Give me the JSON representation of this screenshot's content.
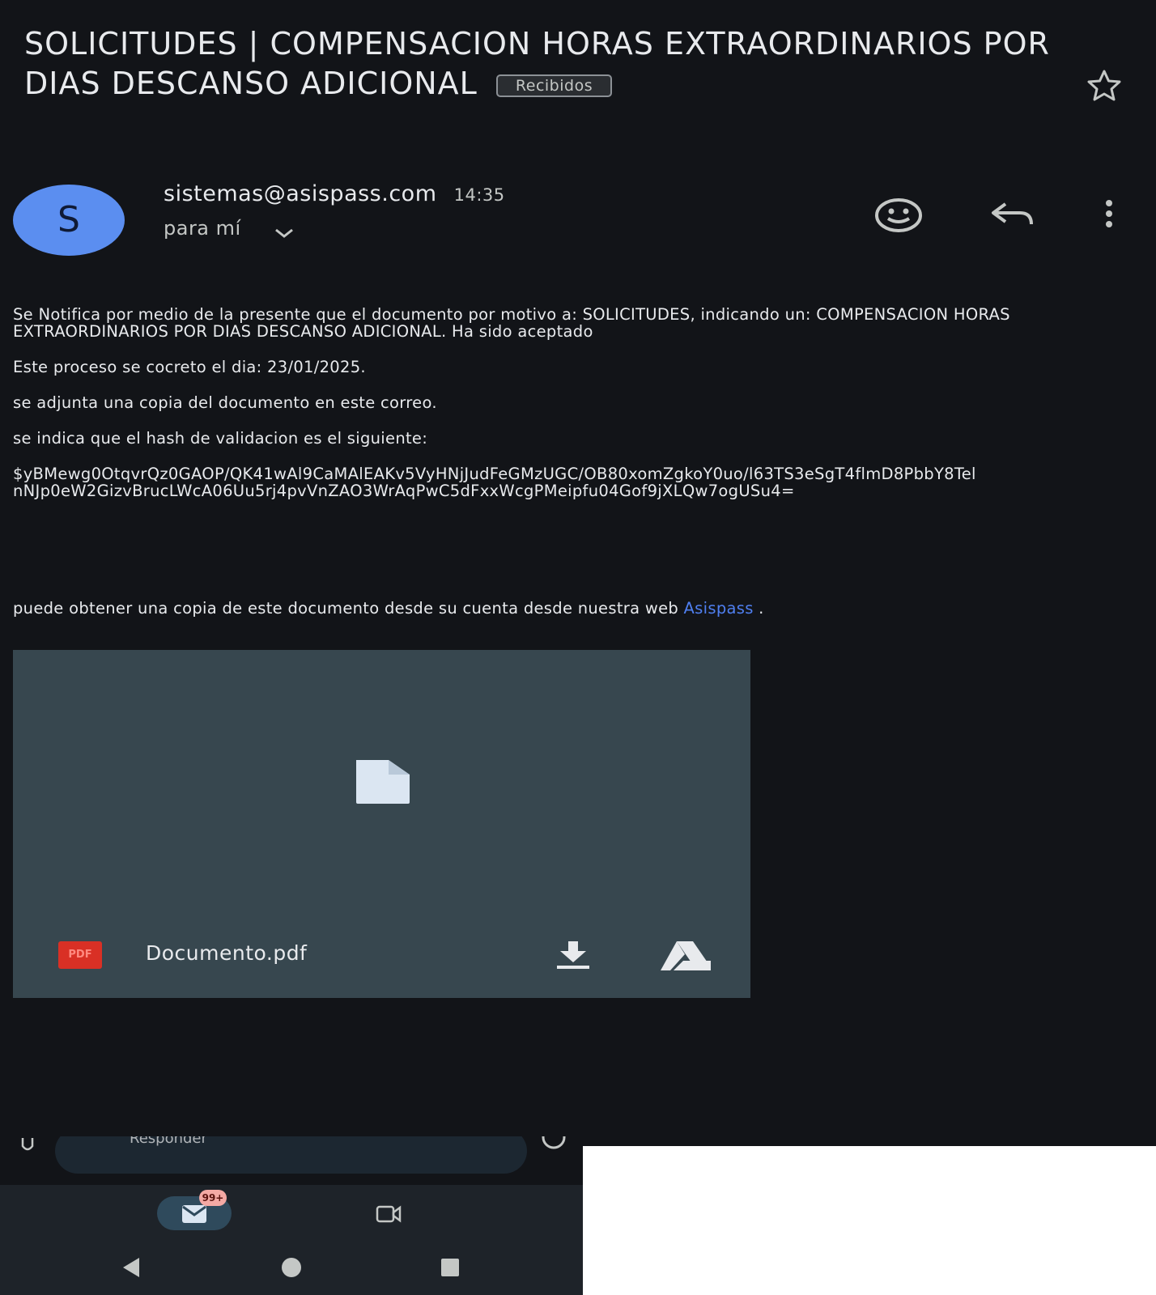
{
  "email": {
    "subject": "SOLICITUDES | COMPENSACION HORAS EXTRAORDINARIOS POR DIAS DESCANSO ADICIONAL",
    "label": "Recibidos",
    "sender_initial": "S",
    "sender": "sistemas@asispass.com",
    "time": "14:35",
    "recipient": "para mí",
    "body": {
      "p1": "Se Notifica por medio de la presente que el documento por motivo a: SOLICITUDES, indicando un: COMPENSACION HORAS EXTRAORDINARIOS POR DIAS DESCANSO ADICIONAL. Ha sido aceptado",
      "p2": "Este proceso se cocreto el dia: 23/01/2025.",
      "p3": "se adjunta una copia del documento en este correo.",
      "p4": "se indica que el hash de validacion es el siguiente:",
      "hash": "$yBMewg0OtqvrQz0GAOP/QK41wAl9CaMAlEAKv5VyHNjJudFeGMzUGC/OB80xomZgkoY0uo/l63TS3eSgT4flmD8PbbY8TelnNJp0eW2GizvBrucLWcA06Uu5rj4pvVnZAO3WrAqPwC5dFxxWcgPMeipfu04Gof9jXLQw7ogUSu4=",
      "p5_before": "puede obtener una copia de este documento desde su cuenta desde nuestra web",
      "link": "Asispass",
      "p5_after": " ."
    },
    "attachment": {
      "badge": "PDF",
      "filename": "Documento.pdf"
    }
  },
  "reply_bar": {
    "placeholder": "Responder"
  },
  "bottom_nav": {
    "mail_badge": "99+"
  },
  "icons": {
    "star": "star-icon",
    "emoji": "emoji-icon",
    "reply": "reply-icon",
    "more": "more-vert-icon",
    "download": "download-icon",
    "drive": "drive-icon",
    "file": "file-icon",
    "mail": "mail-icon",
    "video": "video-icon",
    "back": "back-icon",
    "home": "home-icon",
    "recents": "recents-icon"
  },
  "colors": {
    "background": "#121418",
    "avatar": "#5b8ef0",
    "link": "#4f7ff0",
    "attachment": "#37474f",
    "pdf": "#d93025"
  }
}
